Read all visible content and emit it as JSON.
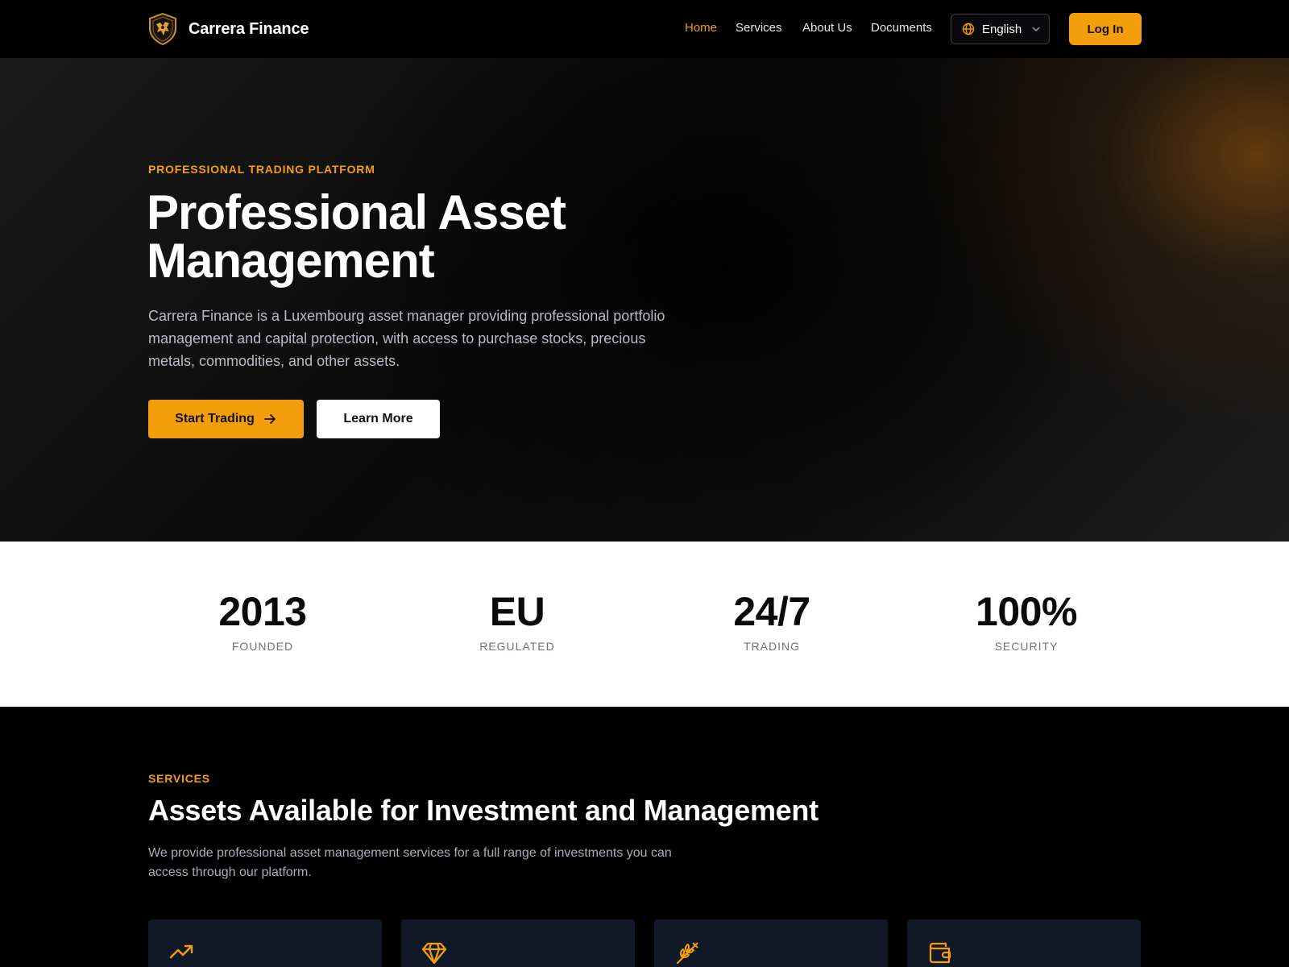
{
  "brand": {
    "name": "Carrera Finance"
  },
  "nav": {
    "links": [
      {
        "label": "Home",
        "active": true
      },
      {
        "label": "Services",
        "active": false
      },
      {
        "label": "About Us",
        "active": false
      },
      {
        "label": "Documents",
        "active": false
      }
    ],
    "language": "English",
    "login_label": "Log In"
  },
  "hero": {
    "eyebrow": "PROFESSIONAL TRADING PLATFORM",
    "title_line1": "Professional Asset",
    "title_line2": "Management",
    "description": "Carrera Finance is a Luxembourg asset manager providing professional portfolio management and capital protection, with access to purchase stocks, precious metals, commodities, and other assets.",
    "primary_button": "Start Trading",
    "secondary_button": "Learn More"
  },
  "stats": [
    {
      "value": "2013",
      "label": "FOUNDED"
    },
    {
      "value": "EU",
      "label": "REGULATED"
    },
    {
      "value": "24/7",
      "label": "TRADING"
    },
    {
      "value": "100%",
      "label": "SECURITY"
    }
  ],
  "services": {
    "eyebrow": "SERVICES",
    "title": "Assets Available for Investment and Management",
    "description": "We provide professional asset management services for a full range of investments you can access through our platform.",
    "cards": [
      {
        "icon": "trending-up-icon"
      },
      {
        "icon": "gem-icon"
      },
      {
        "icon": "wheat-icon"
      },
      {
        "icon": "wallet-icon"
      }
    ]
  },
  "colors": {
    "accent": "#f59e0b",
    "background": "#000000",
    "card": "#111827"
  }
}
